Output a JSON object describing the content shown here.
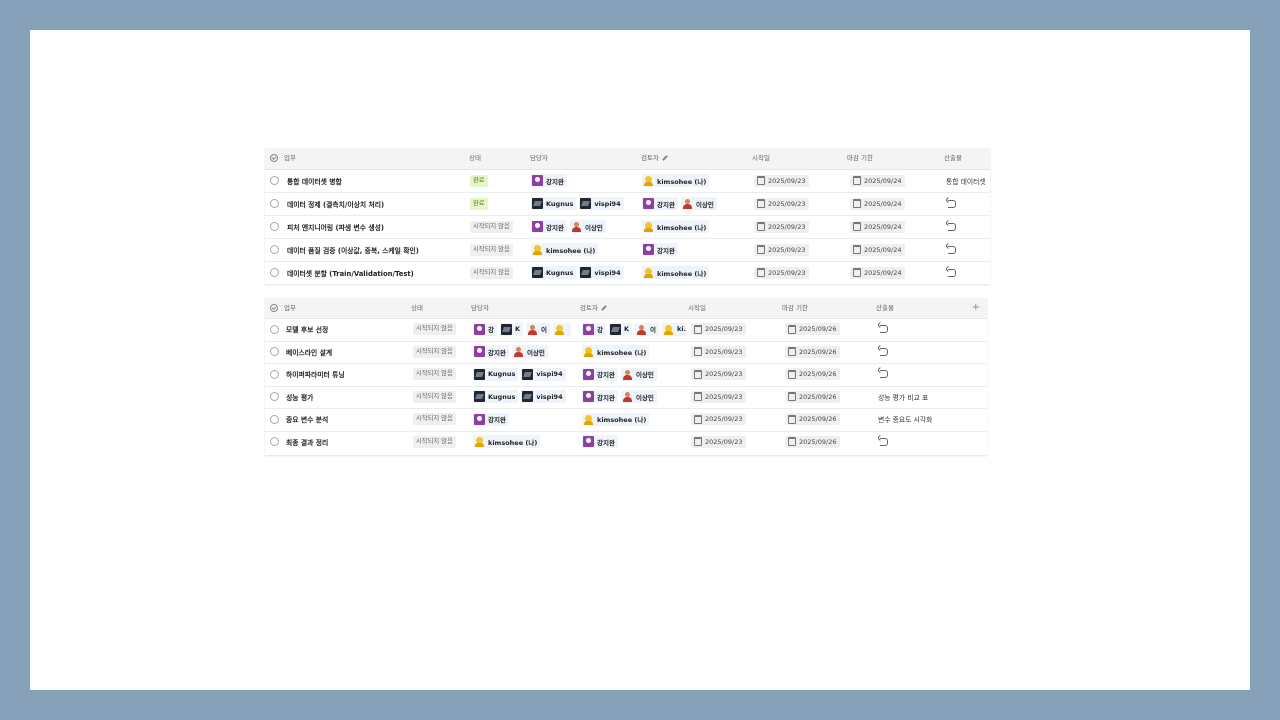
{
  "colors": {
    "frame": "#87a1bb",
    "done_badge": "#e7f5c8",
    "todo_badge": "#efefef",
    "chip": "#eef4fa"
  },
  "table1": {
    "headers": {
      "task": "업무",
      "status": "상태",
      "assignee": "담당자",
      "reviewer": "검토자",
      "start": "시작일",
      "due": "마감 기한",
      "deliverable": "산출물"
    },
    "rows": [
      {
        "task": "통합 데이터셋 병합",
        "status": "완료",
        "start": "2025/09/23",
        "due": "2025/09/24",
        "deliverable": "통합 데이터셋",
        "assignees": [
          "강지완"
        ],
        "reviewers": [
          "kimsohee (나)"
        ]
      },
      {
        "task": "데이터 정제 (결측치/이상치 처리)",
        "status": "완료",
        "start": "2025/09/23",
        "due": "2025/09/24",
        "assignees": [
          "Kugnus",
          "vispi94"
        ],
        "reviewers": [
          "강지완",
          "이상민"
        ]
      },
      {
        "task": "피처 엔지니어링 (파생 변수 생성)",
        "status": "시작되지 않음",
        "start": "2025/09/23",
        "due": "2025/09/24",
        "assignees": [
          "강지완",
          "이상민"
        ],
        "reviewers": [
          "kimsohee (나)"
        ]
      },
      {
        "task": "데이터 품질 검증 (이상값, 중복, 스케일 확인)",
        "status": "시작되지 않음",
        "start": "2025/09/23",
        "due": "2025/09/24",
        "assignees": [
          "kimsohee (나)"
        ],
        "reviewers": [
          "강지완"
        ]
      },
      {
        "task": "데이터셋 분할 (Train/Validation/Test)",
        "status": "시작되지 않음",
        "start": "2025/09/23",
        "due": "2025/09/24",
        "assignees": [
          "Kugnus",
          "vispi94"
        ],
        "reviewers": [
          "kimsohee (나)"
        ]
      }
    ]
  },
  "table2": {
    "headers": {
      "task": "업무",
      "status": "상태",
      "assignee": "담당자",
      "reviewer": "검토자",
      "start": "시작일",
      "due": "마감 기한",
      "deliverable": "산출물",
      "add": "+"
    },
    "rows": [
      {
        "task": "모델 후보 선정",
        "status": "시작되지 않음",
        "start": "2025/09/23",
        "due": "2025/09/26",
        "assignees": [
          "강",
          "K",
          "이",
          ""
        ],
        "reviewers": [
          "강",
          "K",
          "이",
          "ki..."
        ]
      },
      {
        "task": "베이스라인 설계",
        "status": "시작되지 않음",
        "start": "2025/09/23",
        "due": "2025/09/26",
        "assignees": [
          "강지완",
          "이상민"
        ],
        "reviewers": [
          "kimsohee (나)"
        ]
      },
      {
        "task": "하이퍼파라미터 튜닝",
        "status": "시작되지 않음",
        "start": "2025/09/23",
        "due": "2025/09/26",
        "assignees": [
          "Kugnus",
          "vispi94"
        ],
        "reviewers": [
          "강지완",
          "이상민"
        ]
      },
      {
        "task": "성능 평가",
        "status": "시작되지 않음",
        "start": "2025/09/23",
        "due": "2025/09/26",
        "deliverable": "성능 평가 비교 표",
        "assignees": [
          "Kugnus",
          "vispi94"
        ],
        "reviewers": [
          "강지완",
          "이상민"
        ]
      },
      {
        "task": "중요 변수 분석",
        "status": "시작되지 않음",
        "start": "2025/09/23",
        "due": "2025/09/26",
        "deliverable": "변수 중요도 시각화",
        "assignees": [
          "강지완"
        ],
        "reviewers": [
          "kimsohee (나)"
        ]
      },
      {
        "task": "최종 결과 정리",
        "status": "시작되지 않음",
        "start": "2025/09/23",
        "due": "2025/09/26",
        "assignees": [
          "kimsohee (나)"
        ],
        "reviewers": [
          "강지완"
        ]
      }
    ]
  }
}
